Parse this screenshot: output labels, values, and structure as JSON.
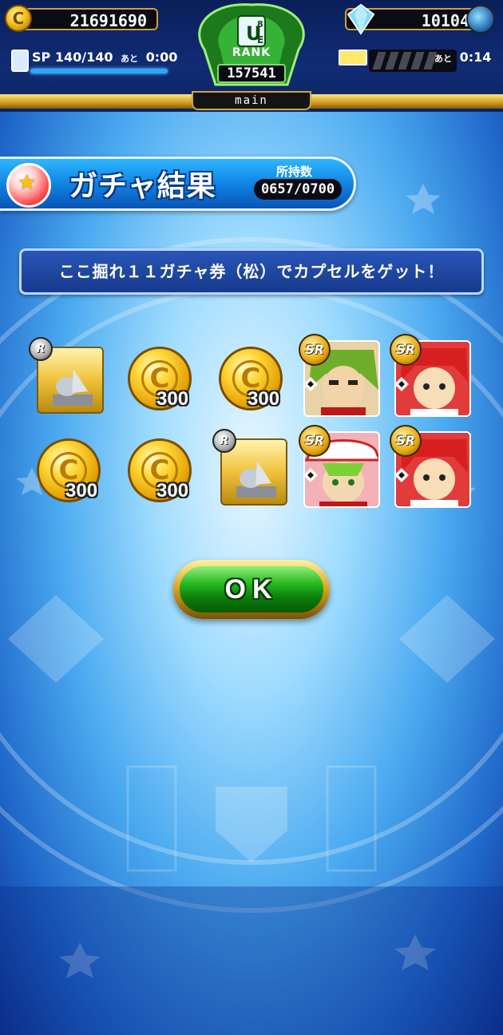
{
  "hud": {
    "coins": "21691690",
    "coin_symbol": "C",
    "gems": "10104",
    "sp_label": "SP",
    "sp_value": "140/140",
    "sp_remaining_label": "あと",
    "sp_timer": "0:00",
    "stamina_remaining_label": "あと",
    "stamina_timer": "0:14",
    "rank_tier": "UE",
    "rank_level": "8",
    "rank_label": "RANK",
    "rank_value": "157541",
    "deck_name": "main"
  },
  "result": {
    "title": "ガチャ結果",
    "inventory_label": "所持数",
    "inventory_value": "0657/0700"
  },
  "message": "ここ掘れ１１ガチャ券（松）でカプセルをゲット！",
  "rewards": {
    "coin_symbol": "C",
    "coin_qty": "300",
    "r_badge": "R",
    "sr_badge": "SR"
  },
  "buttons": {
    "ok_label": "OK"
  },
  "colors": {
    "hud_bg": "#102c74",
    "gold": "#d7a21f",
    "accent_blue": "#0f7fe0",
    "ok_green": "#22b51c"
  }
}
